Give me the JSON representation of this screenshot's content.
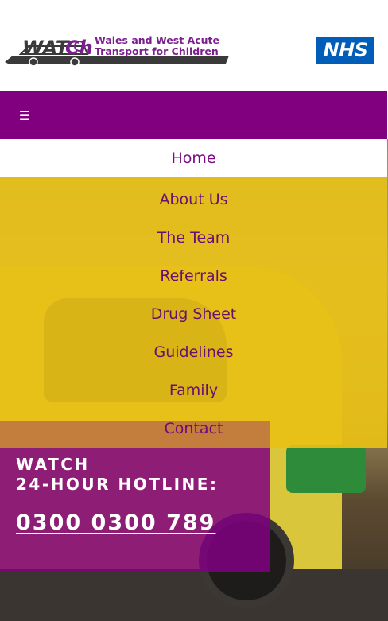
{
  "header": {
    "logo_word": "WATCh",
    "logo_tagline_line1": "Wales and West Acute",
    "logo_tagline_line2": "Transport for Children",
    "nhs_badge": "NHS"
  },
  "topbar": {
    "menu_icon": "hamburger-icon",
    "menu_glyph": "☰",
    "color": "#800080"
  },
  "nav": {
    "items": [
      {
        "label": "Home",
        "active": true
      },
      {
        "label": "About Us",
        "active": false
      },
      {
        "label": "The Team",
        "active": false
      },
      {
        "label": "Referrals",
        "active": false
      },
      {
        "label": "Drug Sheet",
        "active": false
      },
      {
        "label": "Guidelines",
        "active": false
      },
      {
        "label": "Family",
        "active": false
      },
      {
        "label": "Contact",
        "active": false
      }
    ],
    "background": "#e8c016",
    "text_color": "#6a0e70"
  },
  "hotline": {
    "title_line1": "WATCH",
    "title_line2": "24-HOUR HOTLINE:",
    "number": "0300 0300 789"
  },
  "colors": {
    "brand_purple": "#800080",
    "nhs_blue": "#005eb8",
    "menu_yellow": "#e8c016"
  }
}
